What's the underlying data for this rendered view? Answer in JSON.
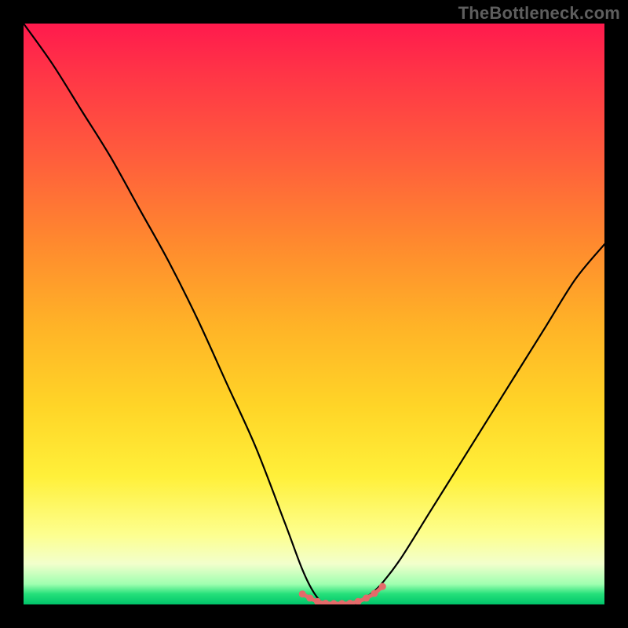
{
  "watermark": "TheBottleneck.com",
  "chart_data": {
    "type": "line",
    "title": "",
    "xlabel": "",
    "ylabel": "",
    "xlim": [
      0,
      100
    ],
    "ylim": [
      0,
      100
    ],
    "grid": false,
    "legend": false,
    "series": [
      {
        "name": "bottleneck-curve",
        "color": "#000000",
        "x": [
          0,
          5,
          10,
          15,
          20,
          25,
          30,
          35,
          40,
          45,
          48,
          50,
          52,
          55,
          57,
          60,
          62,
          65,
          70,
          75,
          80,
          85,
          90,
          95,
          100
        ],
        "values": [
          100,
          93,
          85,
          77,
          68,
          59,
          49,
          38,
          27,
          14,
          6,
          2,
          0,
          0,
          0,
          2,
          4,
          8,
          16,
          24,
          32,
          40,
          48,
          56,
          62
        ]
      }
    ],
    "bead_segment": {
      "color": "#e46a6a",
      "x": [
        48,
        49.3,
        50.6,
        52,
        53.4,
        54.8,
        56.2,
        57.6,
        59,
        60.4,
        61.8
      ],
      "values": [
        1.8,
        1.1,
        0.5,
        0.2,
        0.15,
        0.15,
        0.2,
        0.5,
        1.1,
        1.9,
        3.1
      ]
    },
    "background_gradient_stops": [
      {
        "pos": 0,
        "color": "#ff1a4d"
      },
      {
        "pos": 0.22,
        "color": "#ff5a3d"
      },
      {
        "pos": 0.52,
        "color": "#ffb327"
      },
      {
        "pos": 0.78,
        "color": "#fff03a"
      },
      {
        "pos": 0.93,
        "color": "#f2ffcc"
      },
      {
        "pos": 0.982,
        "color": "#25e07a"
      },
      {
        "pos": 1.0,
        "color": "#00c46a"
      }
    ]
  }
}
